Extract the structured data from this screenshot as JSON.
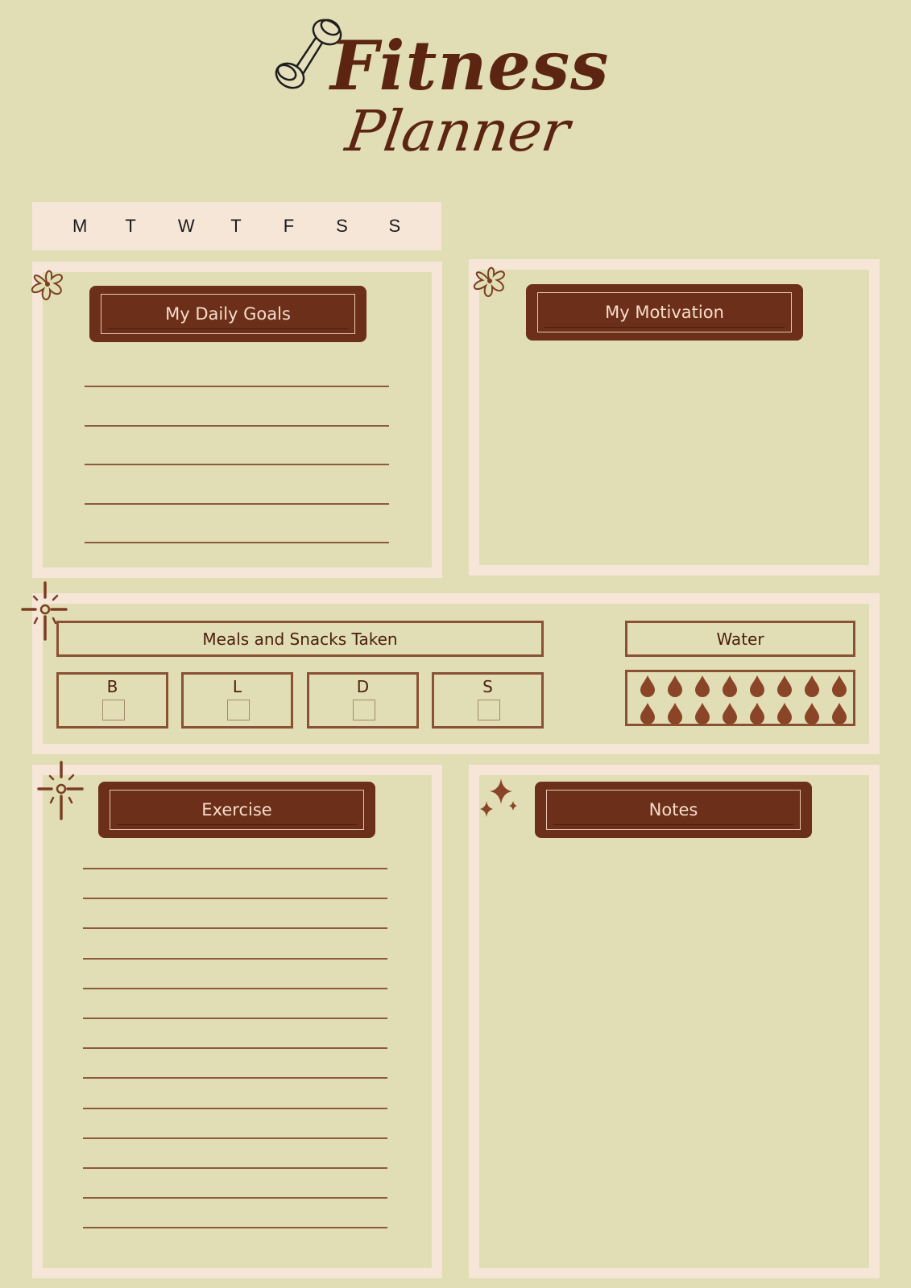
{
  "header": {
    "title_line1": "Fitness",
    "title_line2": "Planner",
    "logo_icon": "dumbbell-icon"
  },
  "weekdays": [
    "M",
    "T",
    "W",
    "T",
    "F",
    "S",
    "S"
  ],
  "sections": {
    "daily_goals": {
      "title": "My Daily Goals",
      "line_count": 5,
      "decor_icon": "flower-icon"
    },
    "motivation": {
      "title": "My Motivation",
      "decor_icon": "flower-icon"
    },
    "meals": {
      "title": "Meals and Snacks Taken",
      "decor_icon": "sun-burst-icon",
      "items": [
        {
          "label": "B",
          "checked": false
        },
        {
          "label": "L",
          "checked": false
        },
        {
          "label": "D",
          "checked": false
        },
        {
          "label": "S",
          "checked": false
        }
      ]
    },
    "water": {
      "title": "Water",
      "drop_count": 16,
      "drop_icon": "water-drop-icon"
    },
    "exercise": {
      "title": "Exercise",
      "line_count": 13,
      "decor_icon": "sun-burst-icon"
    },
    "notes": {
      "title": "Notes",
      "decor_icon": "sparkle-icon"
    }
  },
  "colors": {
    "background": "#e1ddb4",
    "frame": "#f6e6d8",
    "ribbon": "#6c2f19",
    "accent": "#8a5134",
    "title": "#5b2511"
  }
}
